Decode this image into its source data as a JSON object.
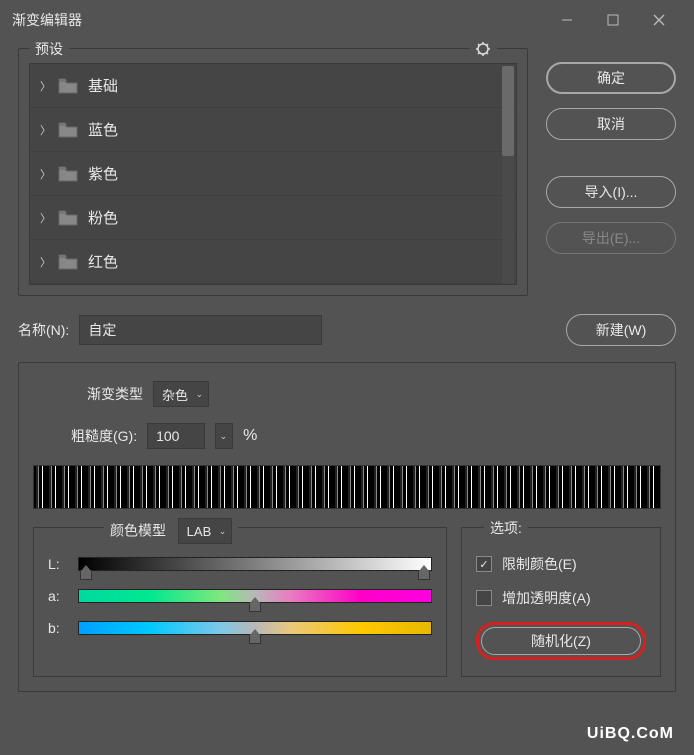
{
  "titlebar": {
    "title": "渐变编辑器"
  },
  "presets": {
    "legend": "预设",
    "items": [
      {
        "label": "基础"
      },
      {
        "label": "蓝色"
      },
      {
        "label": "紫色"
      },
      {
        "label": "粉色"
      },
      {
        "label": "红色"
      }
    ]
  },
  "buttons": {
    "ok": "确定",
    "cancel": "取消",
    "import": "导入(I)...",
    "export": "导出(E)...",
    "new": "新建(W)",
    "randomize": "随机化(Z)"
  },
  "name": {
    "label": "名称(N):",
    "value": "自定"
  },
  "gradient_type": {
    "label": "渐变类型",
    "value": "杂色"
  },
  "roughness": {
    "label": "粗糙度(G):",
    "value": "100",
    "unit": "%"
  },
  "color_model": {
    "label": "颜色模型",
    "value": "LAB"
  },
  "sliders": {
    "l": "L:",
    "a": "a:",
    "b": "b:"
  },
  "options": {
    "legend": "选项:",
    "restrict": "限制颜色(E)",
    "transparency": "增加透明度(A)"
  },
  "watermark": "UiBQ.CoM"
}
